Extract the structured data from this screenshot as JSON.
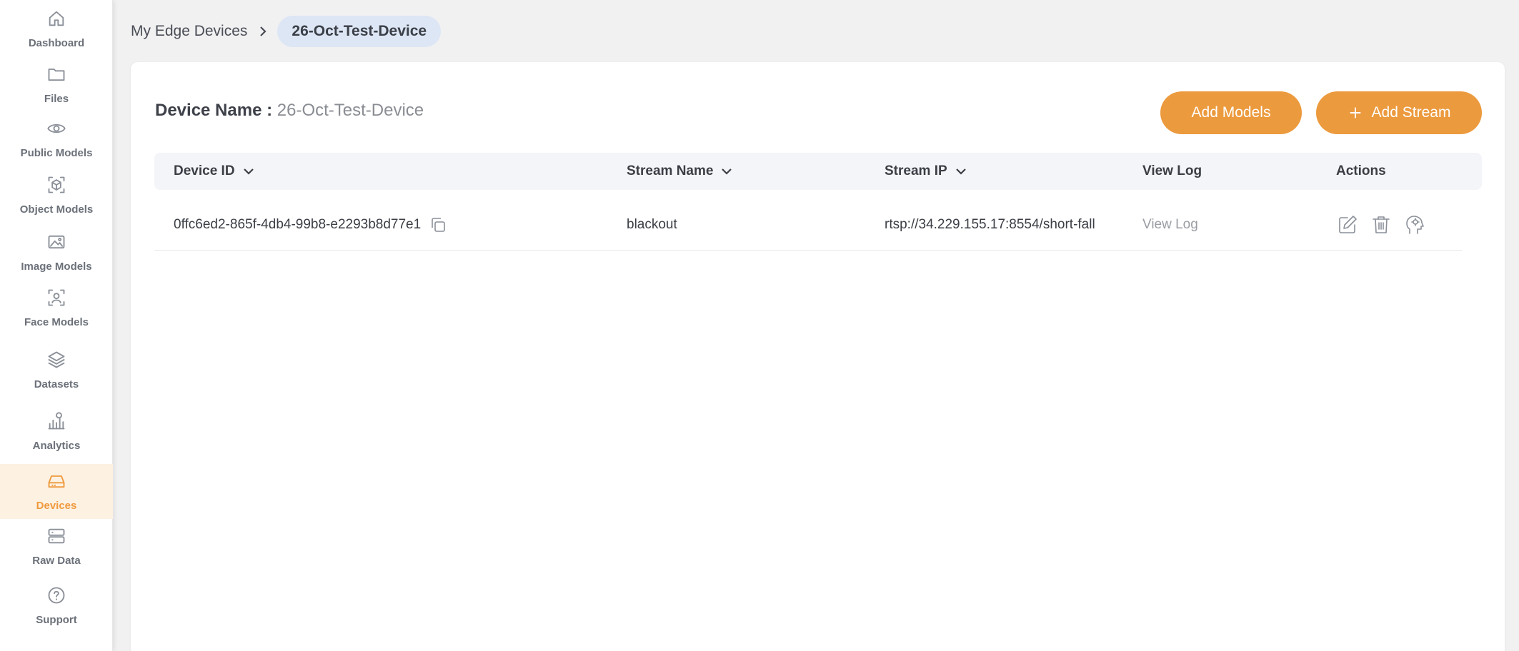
{
  "sidebar": {
    "items": [
      {
        "label": "Dashboard",
        "icon": "home-icon"
      },
      {
        "label": "Files",
        "icon": "folder-icon"
      },
      {
        "label": "Public Models",
        "icon": "eye-icon"
      },
      {
        "label": "Object Models",
        "icon": "cube-icon"
      },
      {
        "label": "Image Models",
        "icon": "image-icon"
      },
      {
        "label": "Face Models",
        "icon": "face-scan-icon"
      },
      {
        "label": "Datasets",
        "icon": "layers-icon"
      },
      {
        "label": "Analytics",
        "icon": "analytics-icon"
      },
      {
        "label": "Devices",
        "icon": "hard-drive-icon",
        "active": true
      },
      {
        "label": "Raw Data",
        "icon": "server-icon"
      },
      {
        "label": "Support",
        "icon": "help-circle-icon"
      }
    ]
  },
  "breadcrumb": {
    "parent": "My Edge Devices",
    "current": "26-Oct-Test-Device"
  },
  "device": {
    "name_label": "Device Name :",
    "name_value": "26-Oct-Test-Device"
  },
  "buttons": {
    "add_models": "Add Models",
    "add_stream": "Add Stream"
  },
  "table": {
    "headers": {
      "device_id": "Device ID",
      "stream_name": "Stream Name",
      "stream_ip": "Stream IP",
      "view_log": "View Log",
      "actions": "Actions"
    },
    "rows": [
      {
        "device_id": "0ffc6ed2-865f-4db4-99b8-e2293b8d77e1",
        "stream_name": "blackout",
        "stream_ip": "rtsp://34.229.155.17:8554/short-fall",
        "view_log": "View Log"
      }
    ]
  },
  "colors": {
    "accent": "#ec9a3e",
    "active_nav_bg": "#fdf1e2",
    "breadcrumb_chip": "#dde6f4"
  }
}
